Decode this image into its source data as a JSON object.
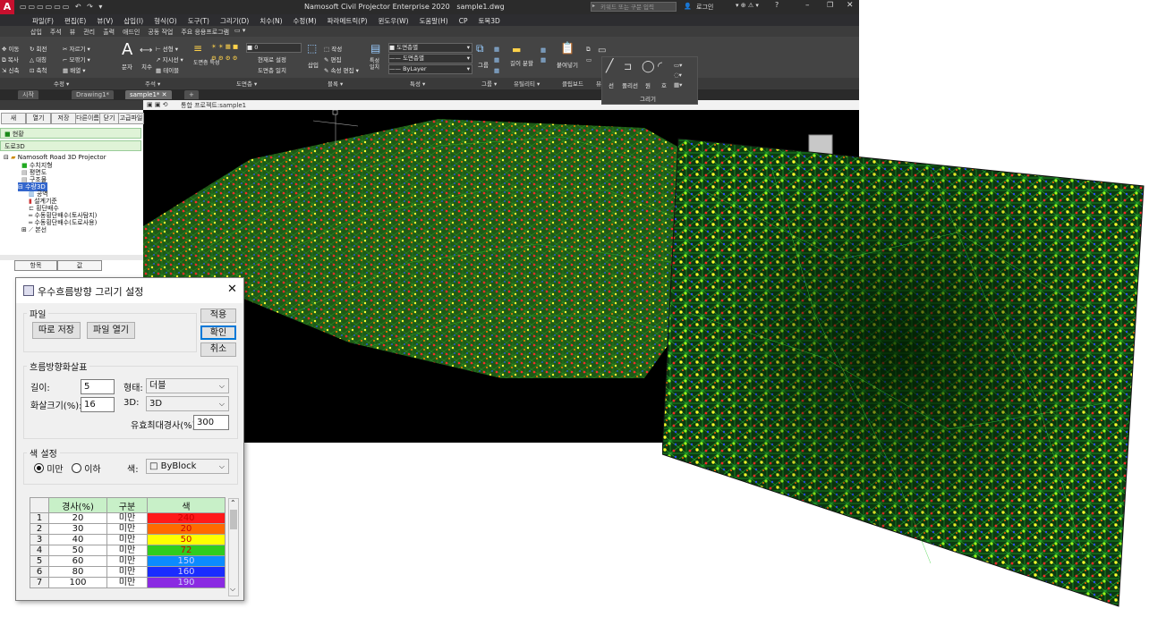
{
  "app": {
    "title": "Namosoft Civil Projector Enterprise 2020",
    "filename": "sample1.dwg",
    "search_placeholder": "키워드 또는 구문 입력",
    "login_label": "로그인",
    "menu": [
      "파일(F)",
      "편집(E)",
      "뷰(V)",
      "삽입(I)",
      "형식(O)",
      "도구(T)",
      "그리기(D)",
      "치수(N)",
      "수정(M)",
      "파라메트릭(P)",
      "윈도우(W)",
      "도움말(H)",
      "CP",
      "토목3D"
    ],
    "ribbon_tabs": [
      "삽입",
      "주석",
      "뷰",
      "관리",
      "출력",
      "애드인",
      "공동 작업",
      "주요 응용프로그램"
    ],
    "ribbon_groups": [
      "수정",
      "주석",
      "도면층",
      "블록",
      "특성",
      "그룹",
      "유틸리티",
      "클립보드",
      "뷰"
    ],
    "ribbon_items": {
      "modify": [
        "이동",
        "회전",
        "자르기",
        "복사",
        "대칭",
        "모깎기",
        "신축",
        "축척",
        "배열"
      ],
      "annotate": [
        "문자",
        "치수",
        "선형",
        "지시선",
        "테이블"
      ],
      "layer_prop": "도면층 특성",
      "layer_tools": [
        "현재로 설정",
        "도면층 일치"
      ],
      "insert": "삽입",
      "block_tools": [
        "작성",
        "편집",
        "속성 편집"
      ],
      "match_prop": "특성 일치",
      "layer_dropdowns": [
        "도면층별",
        "도면층별",
        "ByLayer"
      ],
      "layer_current": "0",
      "group": "그룹",
      "measure": "길이 분할",
      "paste": "붙여넣기",
      "draw_panel": {
        "title": "그리기",
        "items": [
          "선",
          "폴리선",
          "원",
          "호"
        ]
      }
    },
    "doc_tabs": [
      "시작",
      "Drawing1*",
      "sample1*"
    ],
    "toolrow_text": "통합 프로젝트:sample1"
  },
  "left_panel": {
    "buttons": [
      "새",
      "열기",
      "저장",
      "다른이름",
      "닫기",
      "고급파일"
    ],
    "legend_1": "현황",
    "legend_2": "도로3D",
    "tree": [
      "Namosoft Road 3D Projector",
      "수치지형",
      "평면도",
      "구조물",
      "수량3D",
      "공역",
      "설계기준",
      "횡단배수",
      "수동횡단배수(토사탐지)",
      "수동횡단배수(도로사용)",
      "본선"
    ],
    "prop_headers": [
      "항목",
      "값"
    ]
  },
  "dialog": {
    "title": "우수흐름방향 그리기 설정",
    "file_group": "파일",
    "save_as": "따로 저장",
    "open_file": "파일 열기",
    "apply": "적용",
    "ok": "확인",
    "cancel": "취소",
    "arrow_group": "흐름방향화살표",
    "length_label": "길이:",
    "length_value": "5",
    "shape_label": "형태:",
    "shape_value": "더블",
    "arrow_size_label": "화살크기(%):",
    "arrow_size_value": "16",
    "d3_label": "3D:",
    "d3_value": "3D",
    "max_slope_label": "유효최대경사(%):",
    "max_slope_value": "300",
    "color_group": "색 설정",
    "radio_below": "미만",
    "radio_under": "이하",
    "color_label": "색:",
    "color_value": "ByBlock",
    "table_headers": [
      "경사(%)",
      "구분",
      "색"
    ],
    "rows": [
      {
        "no": "1",
        "slope": "20",
        "type": "미만",
        "color": "240",
        "hex": "#ff1a1a"
      },
      {
        "no": "2",
        "slope": "30",
        "type": "미만",
        "color": "20",
        "hex": "#ff6a00"
      },
      {
        "no": "3",
        "slope": "40",
        "type": "미만",
        "color": "50",
        "hex": "#ffff00"
      },
      {
        "no": "4",
        "slope": "50",
        "type": "미만",
        "color": "72",
        "hex": "#2fcc1e"
      },
      {
        "no": "5",
        "slope": "60",
        "type": "미만",
        "color": "150",
        "hex": "#0b8bff"
      },
      {
        "no": "6",
        "slope": "80",
        "type": "미만",
        "color": "160",
        "hex": "#1a2cff"
      },
      {
        "no": "7",
        "slope": "100",
        "type": "미만",
        "color": "190",
        "hex": "#8a2be2"
      }
    ]
  }
}
